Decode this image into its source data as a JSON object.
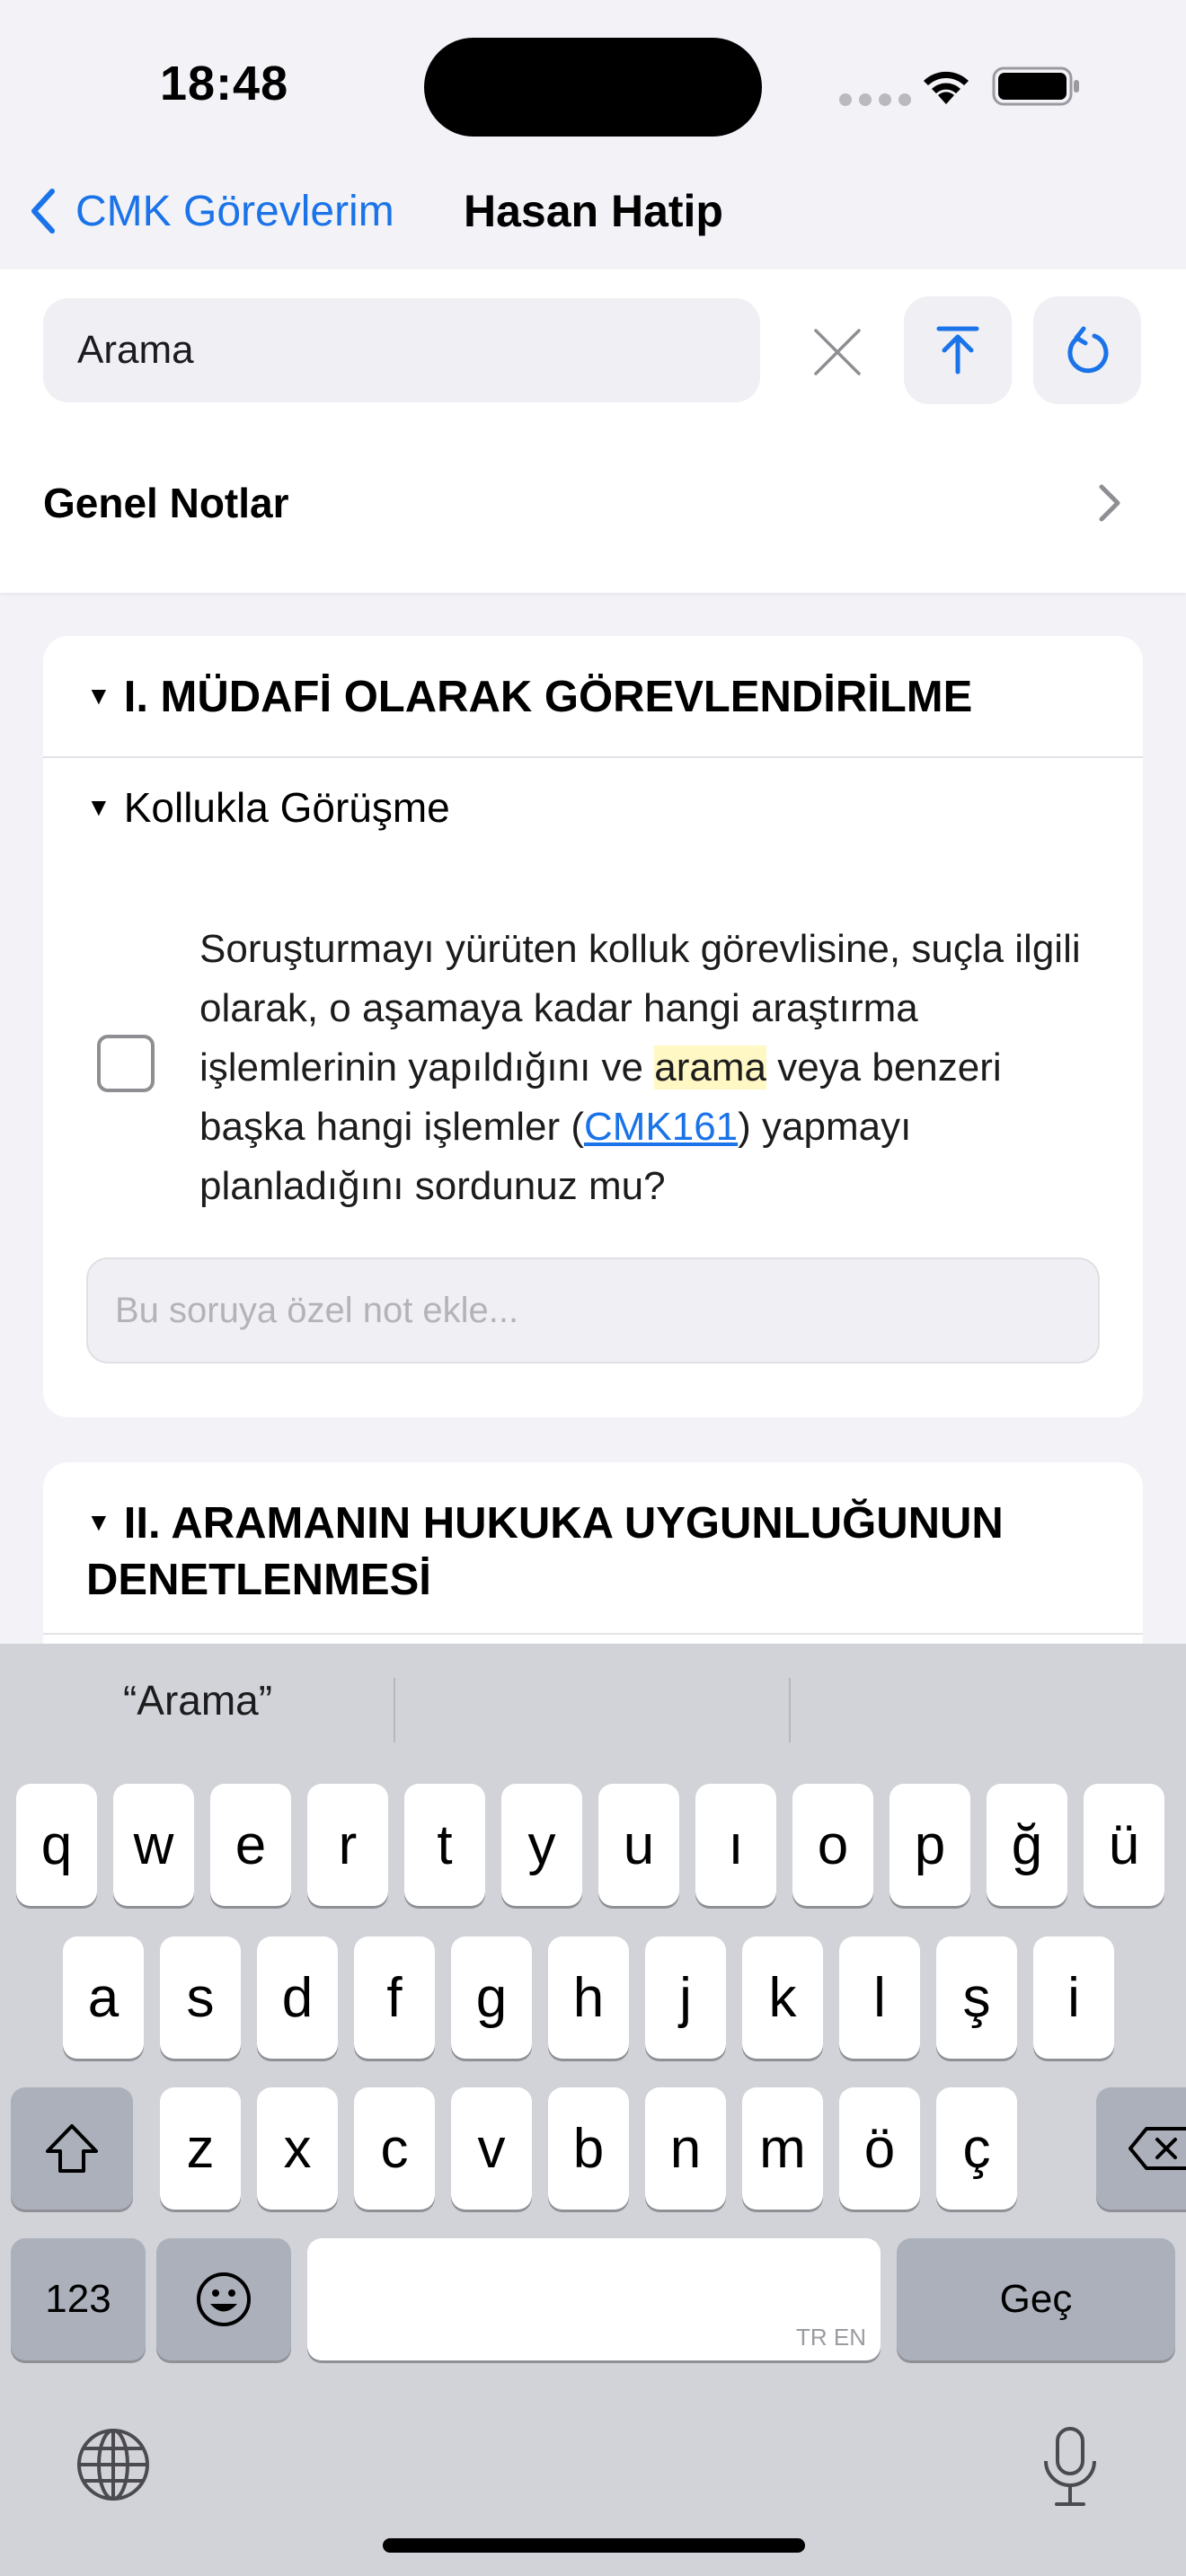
{
  "status": {
    "time": "18:48"
  },
  "nav": {
    "back_label": "CMK Görevlerim",
    "title": "Hasan Hatip"
  },
  "search": {
    "value": "Arama"
  },
  "general_notes": {
    "label": "Genel Notlar"
  },
  "sections": [
    {
      "title": "I. MÜDAFİ OLARAK GÖREVLENDİRİLME",
      "subsections": [
        {
          "title": "Kollukla Görüşme",
          "question": {
            "text_before": "Soruşturmayı yürüten kolluk görevlisine, suçla ilgili olarak, o aşamaya kadar hangi araştırma işlemlerinin yapıldığını ve ",
            "highlight": "arama",
            "text_middle": " veya benzeri başka hangi işlemler (",
            "link": "CMK161",
            "text_after": ") yapmayı planladığını sordunuz mu?",
            "checked": false
          },
          "note_placeholder": "Bu soruya özel not ekle..."
        }
      ]
    },
    {
      "title": "II. ARAMANIN HUKUKA UYGUNLUĞUNUN DENETLENMESİ"
    }
  ],
  "keyboard": {
    "suggestion": "“Arama”",
    "row1": [
      "q",
      "w",
      "e",
      "r",
      "t",
      "y",
      "u",
      "ı",
      "o",
      "p",
      "ğ",
      "ü"
    ],
    "row2": [
      "a",
      "s",
      "d",
      "f",
      "g",
      "h",
      "j",
      "k",
      "l",
      "ş",
      "i"
    ],
    "row3": [
      "z",
      "x",
      "c",
      "v",
      "b",
      "n",
      "m",
      "ö",
      "ç"
    ],
    "numbers_label": "123",
    "return_label": "Geç",
    "space_languages": "TR EN"
  }
}
